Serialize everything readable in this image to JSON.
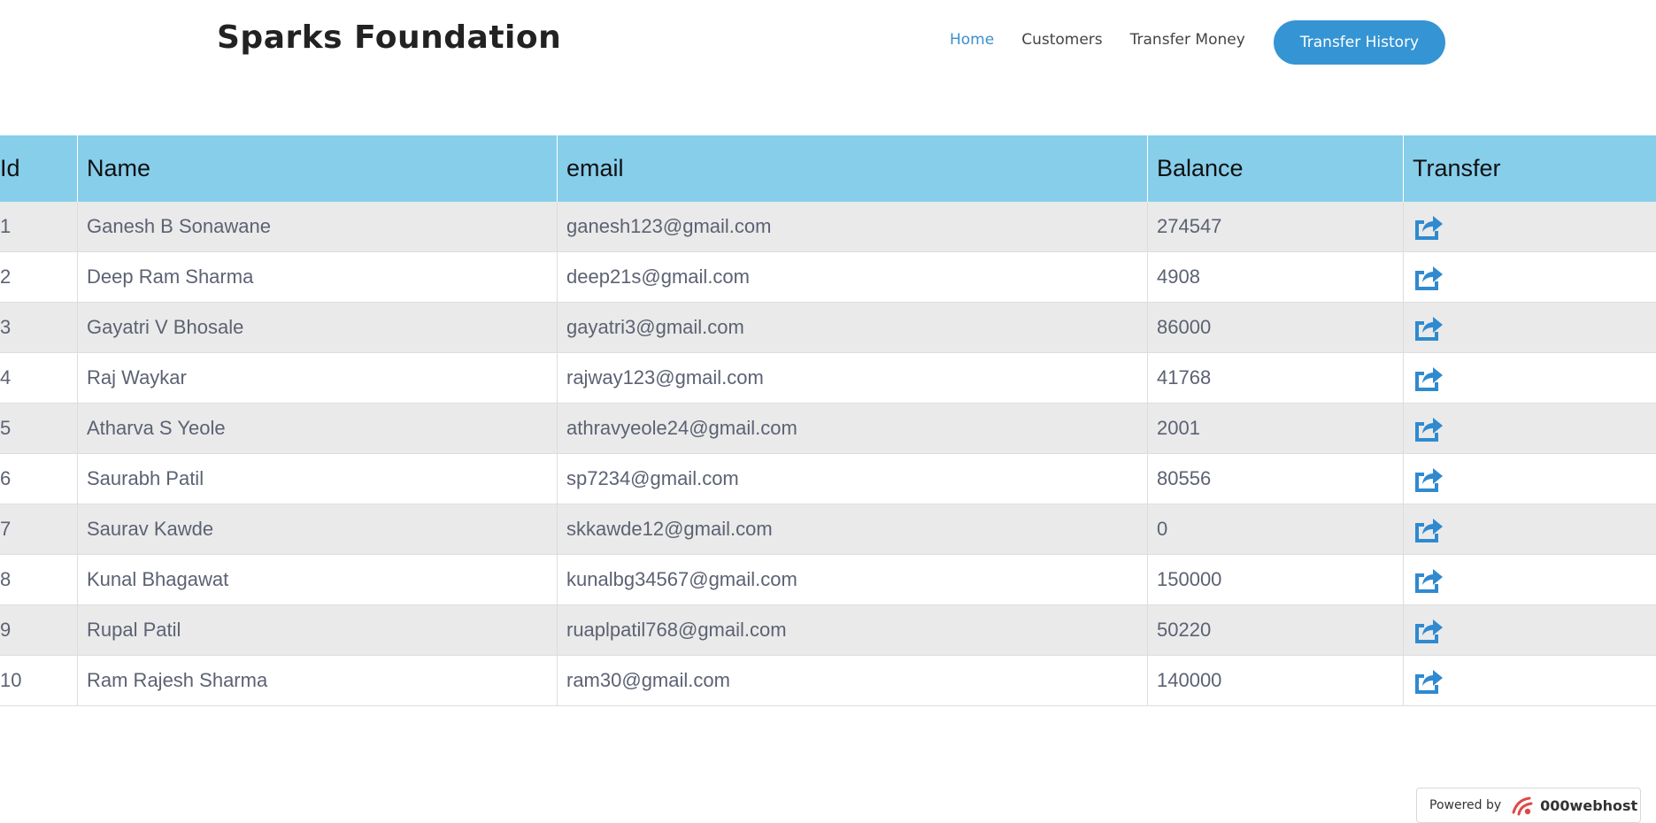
{
  "header": {
    "brand": "Sparks Foundation",
    "nav": [
      {
        "label": "Home",
        "active": true
      },
      {
        "label": "Customers",
        "active": false
      },
      {
        "label": "Transfer Money",
        "active": false
      }
    ],
    "cta_label": "Transfer History"
  },
  "table": {
    "columns": [
      "Id",
      "Name",
      "email",
      "Balance",
      "Transfer"
    ],
    "rows": [
      {
        "id": "1",
        "name": "Ganesh B Sonawane",
        "email": "ganesh123@gmail.com",
        "balance": "274547"
      },
      {
        "id": "2",
        "name": "Deep Ram Sharma",
        "email": "deep21s@gmail.com",
        "balance": "4908"
      },
      {
        "id": "3",
        "name": "Gayatri V Bhosale",
        "email": "gayatri3@gmail.com",
        "balance": "86000"
      },
      {
        "id": "4",
        "name": "Raj Waykar",
        "email": "rajway123@gmail.com",
        "balance": "41768"
      },
      {
        "id": "5",
        "name": "Atharva  S Yeole",
        "email": "athravyeole24@gmail.com",
        "balance": "2001"
      },
      {
        "id": "6",
        "name": "Saurabh Patil",
        "email": "sp7234@gmail.com",
        "balance": "80556"
      },
      {
        "id": "7",
        "name": "Saurav Kawde",
        "email": "skkawde12@gmail.com",
        "balance": "0"
      },
      {
        "id": "8",
        "name": "Kunal Bhagawat",
        "email": "kunalbg34567@gmail.com",
        "balance": "150000"
      },
      {
        "id": "9",
        "name": "Rupal Patil",
        "email": "ruaplpatil768@gmail.com",
        "balance": "50220"
      },
      {
        "id": "10",
        "name": "Ram Rajesh Sharma",
        "email": "ram30@gmail.com",
        "balance": "140000"
      }
    ],
    "transfer_icon": "share-icon"
  },
  "footer": {
    "powered_label": "Powered by",
    "host_name": "000webhost",
    "host_icon": "webhost-logo-icon"
  },
  "colors": {
    "accent": "#3594d4",
    "header_bg": "#87ceeb",
    "row_alt": "#eaeaea",
    "nav_active": "#3a8fd0"
  }
}
